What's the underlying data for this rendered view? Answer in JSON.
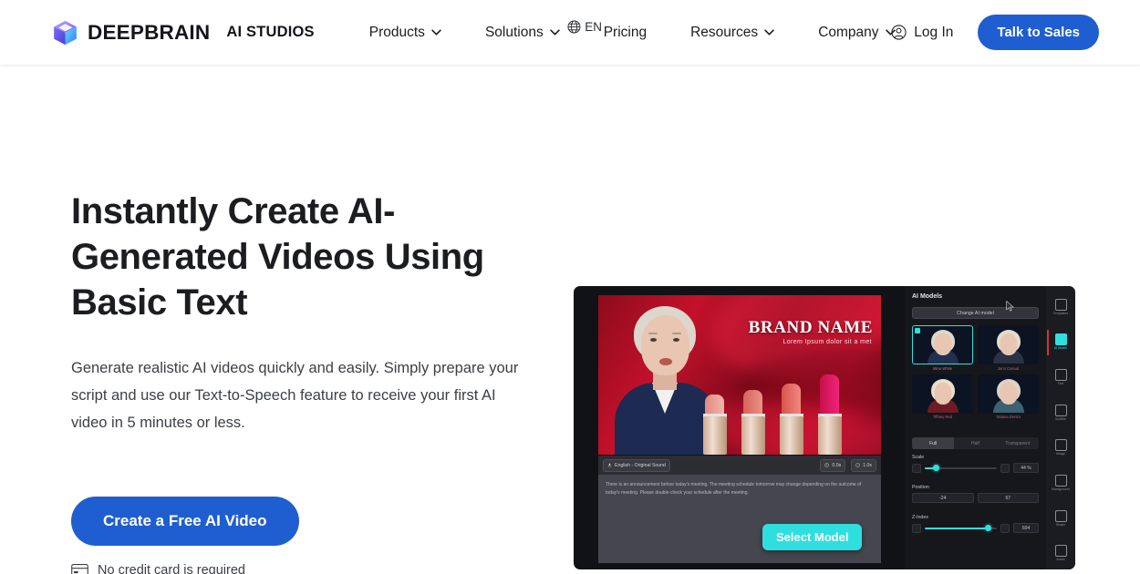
{
  "header": {
    "logo_icon": "cube-logo-icon",
    "brand_name": "DEEPBRAIN",
    "brand_sub": "AI STUDIOS",
    "nav": [
      {
        "label": "Products",
        "has_dropdown": true
      },
      {
        "label": "Solutions",
        "has_dropdown": true
      },
      {
        "label": "Pricing",
        "has_dropdown": false
      },
      {
        "label": "Resources",
        "has_dropdown": true
      },
      {
        "label": "Company",
        "has_dropdown": true
      }
    ],
    "language": {
      "code": "EN",
      "icon": "globe-icon"
    },
    "login": {
      "label": "Log In",
      "icon": "user-circle-icon"
    },
    "cta": {
      "label": "Talk to Sales"
    }
  },
  "hero": {
    "heading": "Instantly Create AI-Generated Videos Using Basic Text",
    "paragraph": "Generate realistic AI videos quickly and easily. Simply prepare your script and use our Text-to-Speech feature to receive your first AI video in 5 minutes or less.",
    "cta_label": "Create a Free AI Video",
    "note": "No credit card is required",
    "note_icon": "credit-card-icon"
  },
  "product": {
    "video": {
      "brand_title": "BRAND NAME",
      "brand_subtitle": "Lorem Ipsum dolor sit a met"
    },
    "toolbar": {
      "language_chip": "English - Original Sound",
      "duration_chip": "0.0s",
      "speed_chip": "1.0x"
    },
    "script_text": "There is an announcement before today's meeting. The meeting schedule tomorrow may change depending on the outcome of today's meeting. Please double-check your schedule after the meeting.",
    "tooltip_label": "Select Model",
    "panel": {
      "title": "AI Models",
      "change_button": "Change AI model",
      "models": [
        {
          "name": "Mina White",
          "selected": true
        },
        {
          "name": "Jenn Casual",
          "selected": false
        },
        {
          "name": "Tiffany Red",
          "selected": false
        },
        {
          "name": "Tatiana Denim",
          "selected": false
        }
      ],
      "tabs": [
        {
          "label": "Full",
          "active": true
        },
        {
          "label": "Half",
          "active": false
        },
        {
          "label": "Transparent",
          "active": false
        }
      ],
      "controls": [
        {
          "label": "Scale",
          "value": "44 %"
        },
        {
          "label": "Position",
          "value_x": "-24",
          "value_y": "67"
        },
        {
          "label": "Z-Index",
          "value": "604"
        }
      ]
    },
    "rail": [
      {
        "label": "Templates",
        "icon": "templates-icon",
        "active": false
      },
      {
        "label": "AI Model",
        "icon": "ai-model-icon",
        "active": true
      },
      {
        "label": "Text",
        "icon": "text-icon",
        "active": false
      },
      {
        "label": "Subtitle",
        "icon": "subtitle-icon",
        "active": false
      },
      {
        "label": "Image",
        "icon": "image-icon",
        "active": false
      },
      {
        "label": "Background",
        "icon": "background-icon",
        "active": false
      },
      {
        "label": "Shape",
        "icon": "shape-icon",
        "active": false
      },
      {
        "label": "Audio",
        "icon": "audio-icon",
        "active": false
      }
    ]
  },
  "colors": {
    "brand_blue": "#1f5ed0",
    "accent_cyan": "#2fdfdf",
    "text_dark": "#1c1d20",
    "app_bg": "#111215"
  }
}
